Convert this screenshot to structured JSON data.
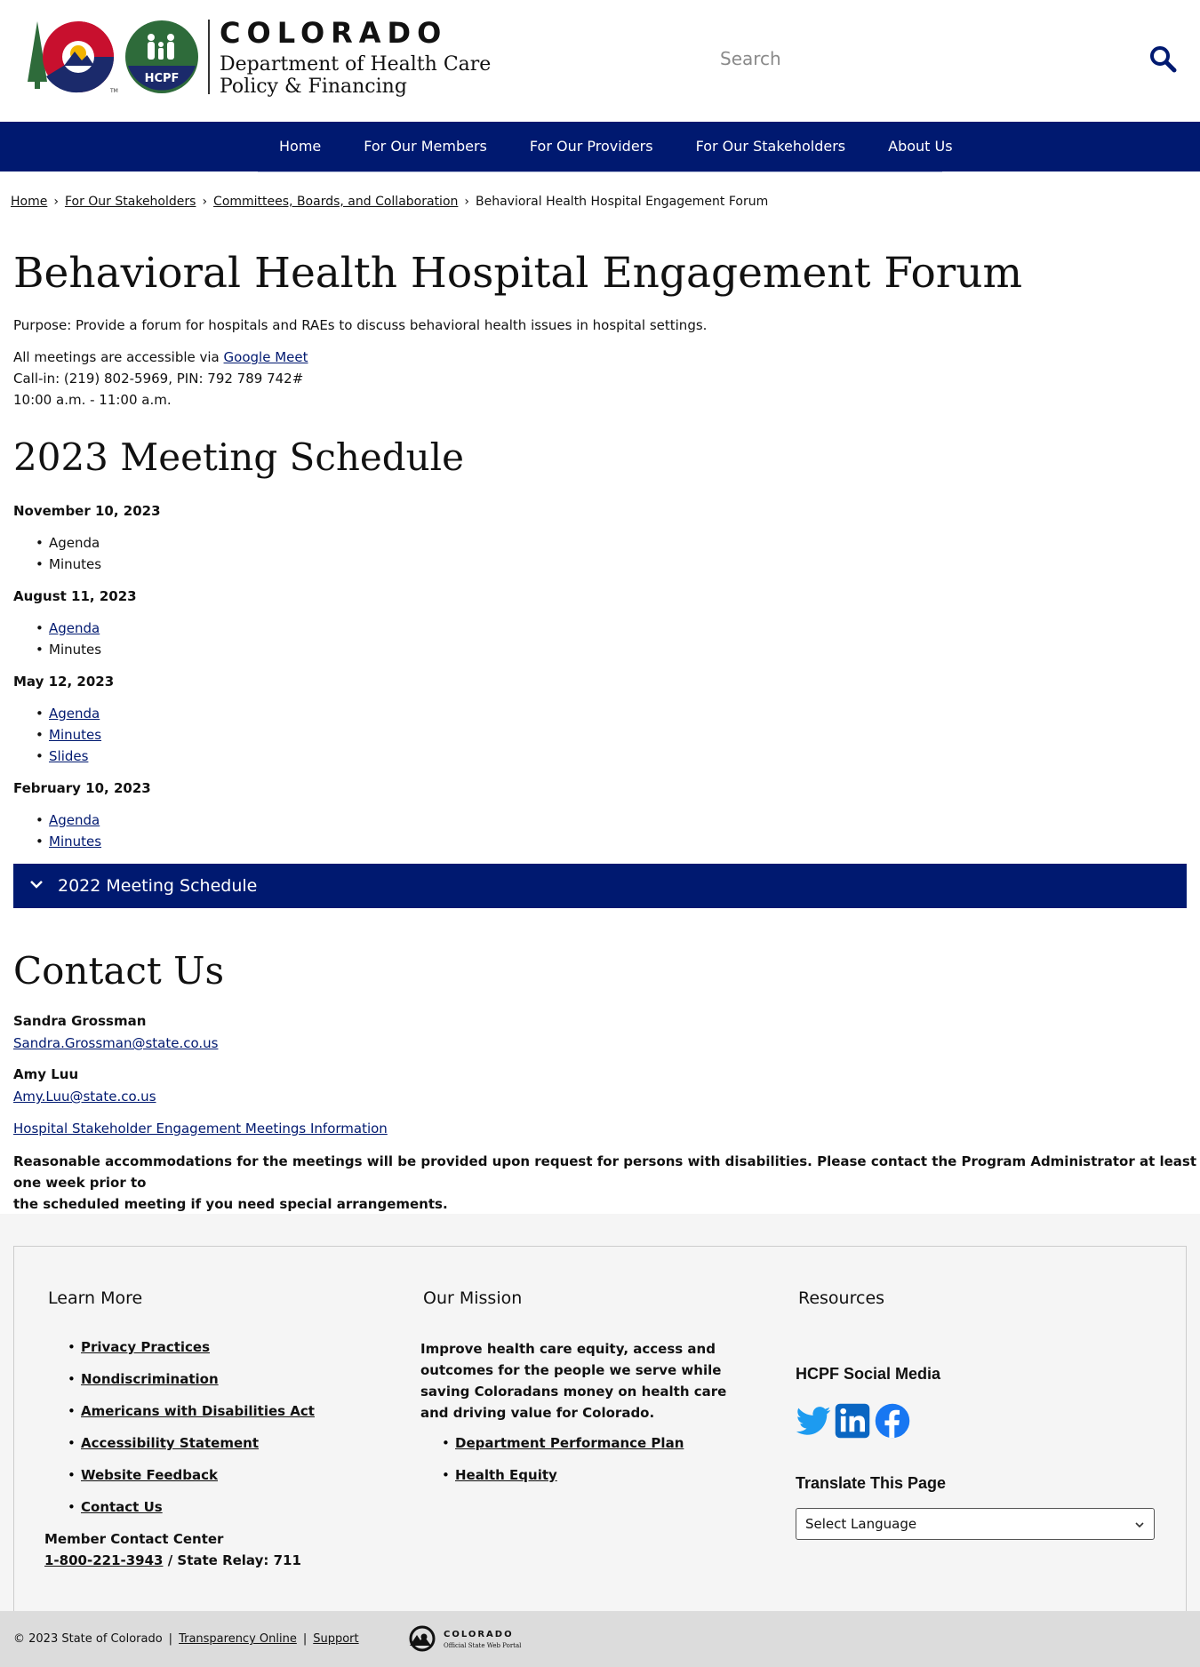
{
  "header": {
    "brand_state": "COLORADO",
    "brand_dept_line1": "Department of Health Care",
    "brand_dept_line2": "Policy & Financing",
    "hcpf_badge": "HCPF",
    "search_placeholder": "Search"
  },
  "nav": {
    "items": [
      "Home",
      "For Our Members",
      "For Our Providers",
      "For Our Stakeholders",
      "About Us"
    ]
  },
  "breadcrumb": {
    "items": [
      "Home",
      "For Our Stakeholders",
      "Committees, Boards, and Collaboration"
    ],
    "current": "Behavioral Health Hospital Engagement Forum"
  },
  "page": {
    "title": "Behavioral Health Hospital Engagement Forum",
    "purpose": "Purpose: Provide a forum for hospitals and RAEs to discuss behavioral health issues in hospital settings.",
    "access_prefix": "All meetings are accessible via ",
    "access_link": "Google Meet",
    "callin": "Call-in: (219) 802-5969, PIN: 792 789 742#",
    "time": "10:00 a.m. - 11:00 a.m."
  },
  "schedule": {
    "heading": "2023 Meeting Schedule",
    "meetings": [
      {
        "date": "November 10, 2023",
        "items": [
          "Agenda",
          "Minutes"
        ]
      },
      {
        "date": "August 11, 2023",
        "items": [
          "Agenda",
          "Minutes"
        ]
      },
      {
        "date": "May 12, 2023",
        "items": [
          "Agenda",
          "Minutes",
          "Slides"
        ]
      },
      {
        "date": "February 10, 2023",
        "items": [
          "Agenda",
          "Minutes"
        ]
      }
    ],
    "accordion_2022": "2022 Meeting Schedule"
  },
  "contact": {
    "heading": "Contact Us",
    "people": [
      {
        "name": "Sandra Grossman",
        "email": "Sandra.Grossman@state.co.us"
      },
      {
        "name": "Amy Luu",
        "email": "Amy.Luu@state.co.us"
      }
    ],
    "info_link": "Hospital Stakeholder Engagement Meetings Information",
    "accommodation_line1": "Reasonable accommodations for the meetings will be provided upon request for persons with disabilities. Please contact the Program Administrator at least one week prior to",
    "accommodation_line2": "the scheduled meeting if you need special arrangements."
  },
  "footer": {
    "learn_more": {
      "title": "Learn More",
      "links": [
        "Privacy Practices",
        "Nondiscrimination",
        "Americans with Disabilities Act",
        "Accessibility Statement",
        "Website Feedback",
        "Contact Us"
      ],
      "contact_center": "Member Contact Center",
      "phone": "1-800-221-3943",
      "relay": " / State Relay: 711"
    },
    "mission": {
      "title": "Our Mission",
      "text": "Improve health care equity, access and outcomes for the people we serve while saving Coloradans money on health care and driving value for Colorado.",
      "links": [
        "Department Performance Plan",
        "Health Equity"
      ]
    },
    "resources": {
      "title": "Resources",
      "social_heading": "HCPF Social Media",
      "social_icons": [
        "twitter-icon",
        "linkedin-icon",
        "facebook-icon"
      ],
      "translate_heading": "Translate This Page",
      "language_selected": "Select Language"
    },
    "bottom": {
      "copyright": "© 2023 State of Colorado",
      "links": [
        "Transparency Online",
        "Support"
      ],
      "portal_name": "COLORADO",
      "portal_sub": "Official State Web Portal"
    }
  },
  "colors": {
    "navy": "#001970",
    "link": "#001970",
    "footer_bg": "#f5f5f5",
    "bottom_bar": "#dcdcdc",
    "social_blue": "#1d9bf0"
  }
}
